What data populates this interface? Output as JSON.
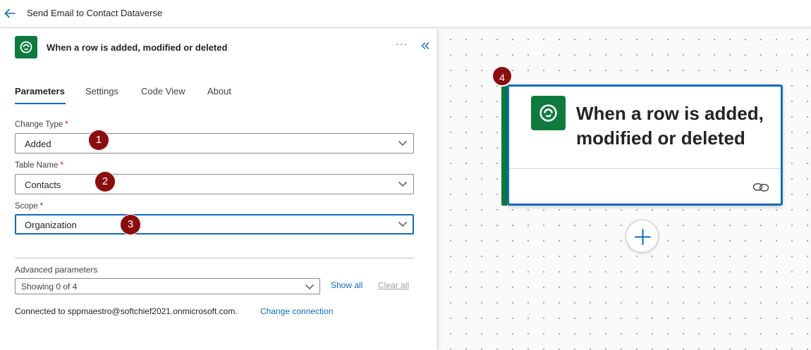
{
  "header": {
    "flow_title": "Send Email to Contact Dataverse"
  },
  "panel": {
    "title": "When a row is added, modified or deleted",
    "more_label": "···",
    "tabs": [
      {
        "label": "Parameters",
        "active": true
      },
      {
        "label": "Settings",
        "active": false
      },
      {
        "label": "Code View",
        "active": false
      },
      {
        "label": "About",
        "active": false
      }
    ],
    "fields": [
      {
        "label": "Change Type",
        "required_mark": "*",
        "value": "Added",
        "marker": "1"
      },
      {
        "label": "Table Name",
        "required_mark": "*",
        "value": "Contacts",
        "marker": "2"
      },
      {
        "label": "Scope",
        "required_mark": "*",
        "value": "Organization",
        "marker": "3"
      }
    ],
    "advanced": {
      "label": "Advanced parameters",
      "value": "Showing 0 of 4",
      "show_all": "Show all",
      "clear_all": "Clear all"
    },
    "connection": {
      "text": "Connected to sppmaestro@softchief2021.onmicrosoft.com.",
      "change_label": "Change connection"
    }
  },
  "canvas": {
    "card_title": "When a row is added, modified or deleted",
    "marker": "4"
  },
  "icons": {
    "back": "arrow-left-icon",
    "dataverse": "dataverse-icon",
    "collapse": "double-chevron-left-icon",
    "chevron": "chevron-down-icon",
    "link": "link-icon",
    "add": "plus-icon"
  },
  "colors": {
    "accent": "#0f6cbd",
    "dataverse_green": "#0e7a3f",
    "marker_red": "#8b0e0e",
    "required_red": "#c50f1f"
  }
}
